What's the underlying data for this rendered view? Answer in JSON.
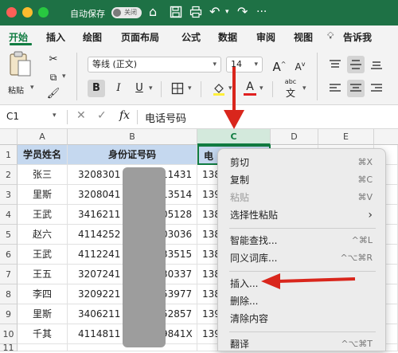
{
  "titlebar": {
    "autosave_label": "自动保存",
    "toggle_label": "关闭",
    "colors": {
      "bar": "#1e7145",
      "close": "#ff5f57",
      "minimize": "#febc2e",
      "zoom": "#28c840"
    }
  },
  "ribbon_tabs": [
    "开始",
    "插入",
    "绘图",
    "页面布局",
    "公式",
    "数据",
    "审阅",
    "视图",
    "告诉我"
  ],
  "ribbon": {
    "paste_label": "粘贴",
    "font_name": "等线 (正文)",
    "font_size": "14",
    "bold": "B",
    "italic": "I",
    "underline": "U",
    "increase_font": "A",
    "decrease_font": "A",
    "font_color": "A",
    "phonetic": "abc"
  },
  "formula_bar": {
    "name_box": "C1",
    "fx": "fx",
    "content": "电话号码"
  },
  "sheet": {
    "columns": [
      "A",
      "B",
      "C",
      "D",
      "E"
    ],
    "rows": [
      "1",
      "2",
      "3",
      "4",
      "5",
      "6",
      "7",
      "8",
      "9",
      "10",
      "11"
    ],
    "cells": [
      [
        "学员姓名",
        "身份证号码",
        "电"
      ],
      [
        "张三",
        "3208301",
        "11431",
        "138"
      ],
      [
        "里斯",
        "3208041",
        "13514",
        "139"
      ],
      [
        "王武",
        "3416211",
        "05128",
        "138"
      ],
      [
        "赵六",
        "4114252",
        "03036",
        "138"
      ],
      [
        "王武",
        "4112241",
        "33515",
        "138"
      ],
      [
        "王五",
        "3207241",
        "30337",
        "138"
      ],
      [
        "李四",
        "3209221",
        "53977",
        "138"
      ],
      [
        "里斯",
        "3406211",
        "52857",
        "139"
      ],
      [
        "千其",
        "4114811",
        "9841X",
        "139"
      ]
    ]
  },
  "context_menu": {
    "items": [
      {
        "label": "剪切",
        "shortcut": "⌘X"
      },
      {
        "label": "复制",
        "shortcut": "⌘C"
      },
      {
        "label": "粘贴",
        "shortcut": "⌘V"
      },
      {
        "label": "选择性粘贴",
        "shortcut": "›"
      },
      {
        "label": "智能查找...",
        "shortcut": "^⌘L"
      },
      {
        "label": "同义词库...",
        "shortcut": "^⌥⌘R"
      },
      {
        "label": "插入...",
        "shortcut": ""
      },
      {
        "label": "删除...",
        "shortcut": ""
      },
      {
        "label": "清除内容",
        "shortcut": ""
      },
      {
        "label": "翻译",
        "shortcut": "^⌥⌘T"
      }
    ]
  },
  "annotation_color": "#d9261c"
}
